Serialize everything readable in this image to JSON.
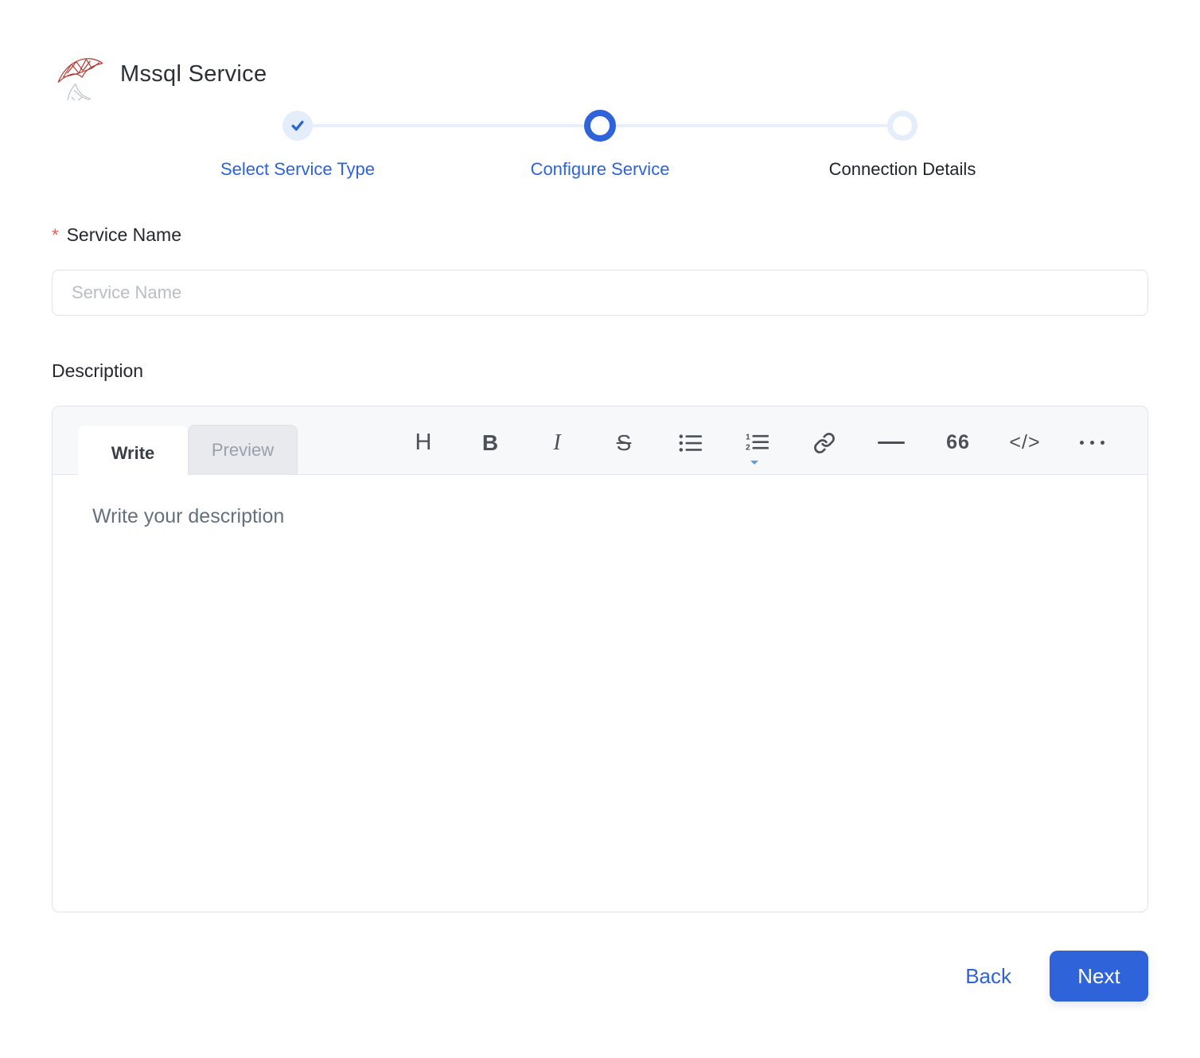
{
  "header": {
    "title": "Mssql Service",
    "logo": "mssql-sql-server-logo"
  },
  "stepper": {
    "steps": [
      {
        "label": "Select Service Type",
        "state": "completed"
      },
      {
        "label": "Configure Service",
        "state": "active"
      },
      {
        "label": "Connection Details",
        "state": "pending"
      }
    ]
  },
  "form": {
    "service_name": {
      "required_marker": "*",
      "label": "Service Name",
      "placeholder": "Service Name",
      "value": ""
    },
    "description": {
      "label": "Description",
      "tabs": [
        {
          "label": "Write",
          "active": true
        },
        {
          "label": "Preview",
          "active": false
        }
      ],
      "toolbar": {
        "items": [
          {
            "name": "heading",
            "glyph": "H"
          },
          {
            "name": "bold",
            "glyph": "B"
          },
          {
            "name": "italic",
            "glyph": "I"
          },
          {
            "name": "strikethrough",
            "glyph": "S"
          },
          {
            "name": "unordered-list",
            "glyph": ""
          },
          {
            "name": "ordered-list",
            "glyph": ""
          },
          {
            "name": "link",
            "glyph": ""
          },
          {
            "name": "horizontal-rule",
            "glyph": ""
          },
          {
            "name": "quote",
            "glyph": "66"
          },
          {
            "name": "code",
            "glyph": "</>"
          },
          {
            "name": "more",
            "glyph": ""
          }
        ]
      },
      "placeholder": "Write your description",
      "value": ""
    }
  },
  "footer": {
    "back_label": "Back",
    "next_label": "Next"
  },
  "colors": {
    "primary_blue": "#2e63d9",
    "pale_blue": "#e4eefb",
    "danger_red": "#ee5a50",
    "toolbar_icon": "#4c5058"
  }
}
